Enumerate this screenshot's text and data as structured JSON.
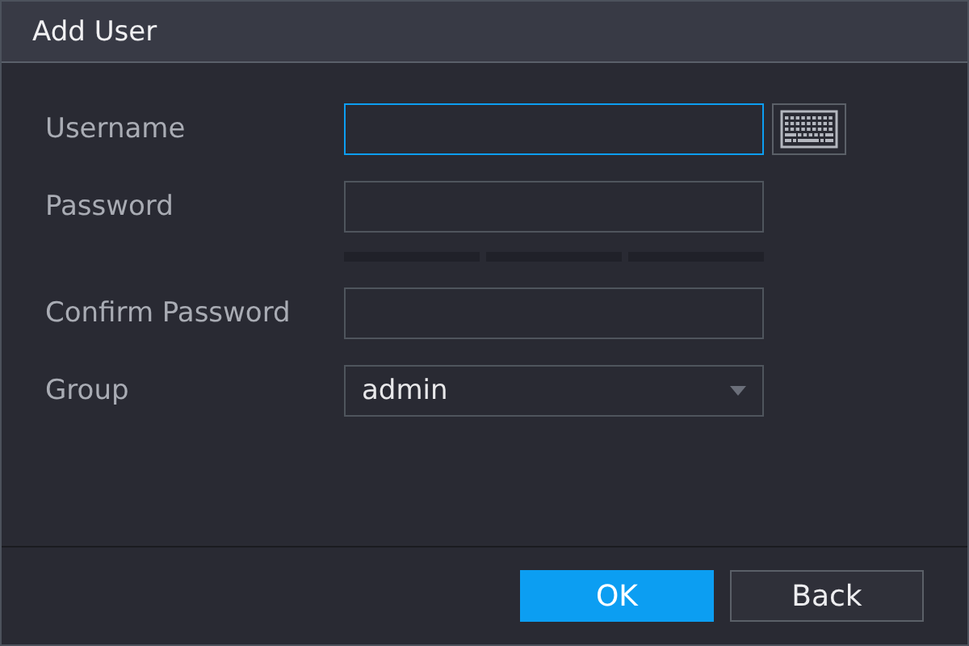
{
  "window": {
    "title": "Add User"
  },
  "fields": [
    {
      "kind": "text",
      "label": "Username",
      "focused": true,
      "keyboard": true
    },
    {
      "kind": "password",
      "label": "Password",
      "focused": false,
      "keyboard": false,
      "strength_meter": true
    },
    {
      "kind": "password",
      "label": "Confirm Password",
      "focused": false,
      "keyboard": false
    },
    {
      "kind": "select",
      "label": "Group",
      "value": "admin",
      "focused": false,
      "keyboard": false
    }
  ],
  "buttons": [
    {
      "label": "OK",
      "primary": true
    },
    {
      "label": "Back",
      "primary": false
    }
  ]
}
